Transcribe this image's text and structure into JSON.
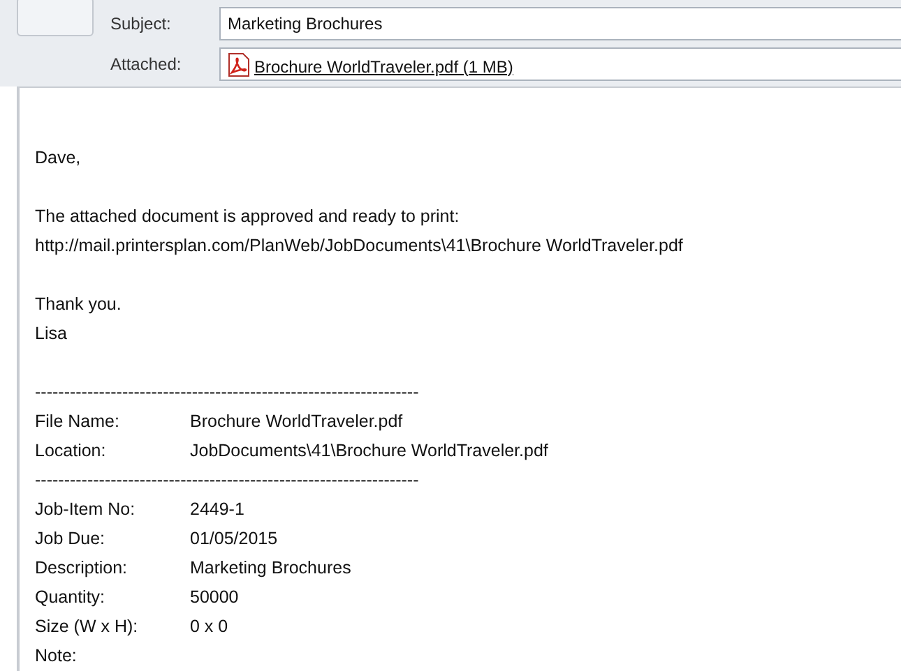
{
  "header": {
    "subject": {
      "label": "Subject:",
      "value": "Marketing Brochures"
    },
    "attached": {
      "label": "Attached:",
      "file": "Brochure WorldTraveler.pdf (1 MB)"
    }
  },
  "body": {
    "greeting": "Dave,",
    "message": [
      "The attached document is approved and ready to print:",
      "http://mail.printersplan.com/PlanWeb/JobDocuments\\41\\Brochure WorldTraveler.pdf"
    ],
    "closing": [
      "Thank you.",
      "Lisa"
    ],
    "separator": "------------------------------------------------------------------",
    "file_fields": [
      {
        "label": "File Name:",
        "value": "Brochure WorldTraveler.pdf"
      },
      {
        "label": "Location:",
        "value": "JobDocuments\\41\\Brochure WorldTraveler.pdf"
      }
    ],
    "job_fields": [
      {
        "label": "Job-Item No:",
        "value": "2449-1"
      },
      {
        "label": "Job Due:",
        "value": "01/05/2015"
      },
      {
        "label": "Description:",
        "value": "Marketing Brochures"
      },
      {
        "label": "Quantity:",
        "value": "50000"
      },
      {
        "label": "Size (W x H):",
        "value": "0 x 0"
      },
      {
        "label": "Note:"
      }
    ]
  }
}
